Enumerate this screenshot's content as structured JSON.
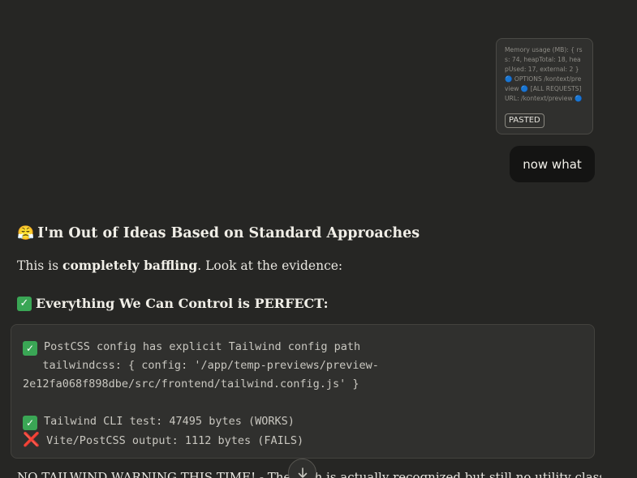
{
  "pasted": {
    "preview_text": "Memory usage (MB): { rss: 74, heapTotal: 18, heapUsed: 17, external: 2 } 🔵 OPTIONS /kontext/preview 🔵 [ALL REQUESTS] URL: /kontext/preview 🔵 [A...",
    "badge": "PASTED"
  },
  "user_message": "now what",
  "response": {
    "heading_emoji": "😤",
    "heading": "I'm Out of Ideas Based on Standard Approaches",
    "intro_prefix": "This is ",
    "intro_bold": "completely baffling",
    "intro_suffix": ". Look at the evidence:",
    "subheading_check": "✓",
    "subheading": "Everything We Can Control is PERFECT:",
    "code": {
      "check": "✓",
      "cross": "❌",
      "line1": "PostCSS config has explicit Tailwind config path",
      "line2": "   tailwindcss: { config: '/app/temp-previews/preview-",
      "line3": "2e12fa068f898dbe/src/frontend/tailwind.config.js' }",
      "line5": "Tailwind CLI test: 47495 bytes (WORKS)",
      "line6": "Vite/PostCSS output: 1112 bytes (FAILS)"
    },
    "trailing_text": "NO TAILWIND WARNING THIS TIME! - The path is actually recognized but still no utility classes"
  },
  "icons": {
    "scroll_down": "arrow-down-icon"
  }
}
